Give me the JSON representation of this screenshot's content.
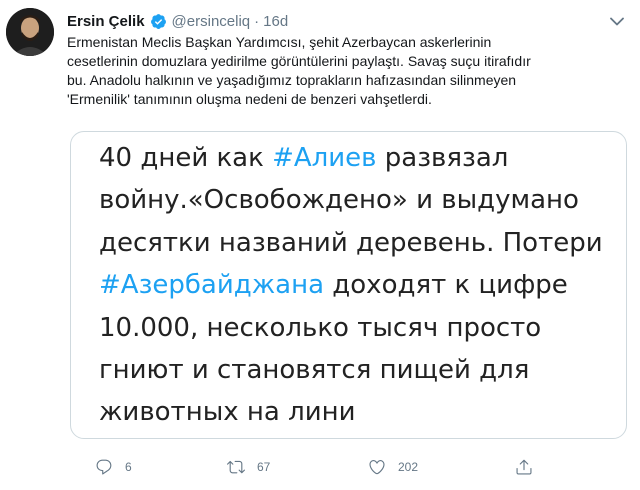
{
  "tweet": {
    "author_name": "Ersin Çelik",
    "handle": "@ersinceliq",
    "separator": "·",
    "time": "16d",
    "text": "Ermenistan Meclis Başkan Yardımcısı, şehit Azerbaycan askerlerinin\ncesetlerinin domuzlara yedirilme görüntülerini paylaştı. Savaş suçu itirafıdır\nbu. Anadolu halkının ve yaşadığımız toprakların hafızasından silinmeyen\n'Ermenilik' tanımının oluşma nedeni de benzeri vahşetlerdi.",
    "media_lines": [
      {
        "before": "40 дней как ",
        "tag": "#Алиев",
        "after": " развязал"
      },
      {
        "before": "войну.«Освобождено» и выдумано",
        "tag": "",
        "after": ""
      },
      {
        "before": "десятки названий деревень. Потери",
        "tag": "",
        "after": ""
      },
      {
        "before": "",
        "tag": "#Азербайджана",
        "after": " доходят к цифре"
      },
      {
        "before": "10.000, несколько тысяч просто",
        "tag": "",
        "after": ""
      },
      {
        "before": "гниют и становятся пищей для",
        "tag": "",
        "after": ""
      },
      {
        "before": "животных на лини",
        "tag": "",
        "after": ""
      }
    ],
    "actions": {
      "reply_count": "6",
      "retweet_count": "67",
      "like_count": "202"
    }
  },
  "colors": {
    "accent": "#1da1f2",
    "muted": "#657786",
    "text": "#14171a",
    "border": "#cfd9de"
  },
  "icons": [
    "avatar",
    "verified-badge-icon",
    "more-chevron-icon",
    "reply-icon",
    "retweet-icon",
    "like-icon",
    "share-icon"
  ]
}
